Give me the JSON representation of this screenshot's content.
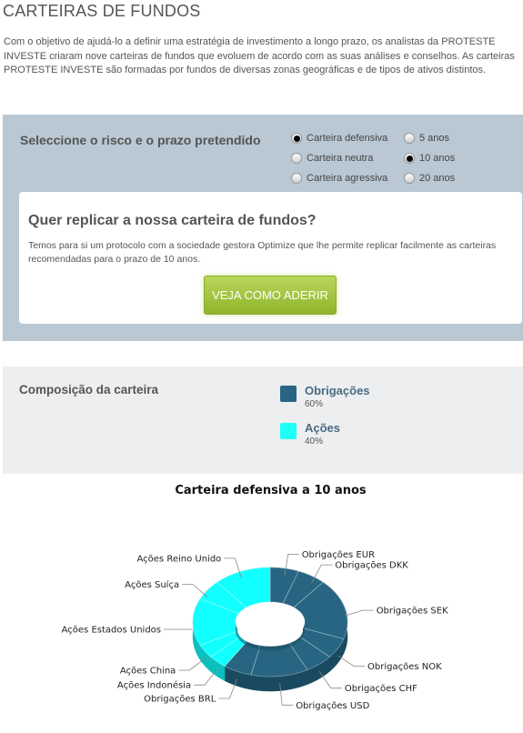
{
  "page": {
    "title": "CARTEIRAS DE FUNDOS",
    "intro": "Com o objetivo de ajudá-lo a definir uma estratégia de investimento a longo prazo, os analistas da PROTESTE INVESTE criaram nove carteiras de fundos que evoluem de acordo com as suas análises e conselhos. As carteiras PROTESTE INVESTE são formadas por fundos de diversas zonas geográficas e de tipos de ativos distintos."
  },
  "selector": {
    "label": "Seleccione o risco e o prazo pretendido",
    "risk_options": [
      {
        "label": "Carteira defensiva",
        "selected": true
      },
      {
        "label": "Carteira neutra",
        "selected": false
      },
      {
        "label": "Carteira agressiva",
        "selected": false
      }
    ],
    "term_options": [
      {
        "label": "5 anos",
        "selected": false
      },
      {
        "label": "10 anos",
        "selected": true
      },
      {
        "label": "20 anos",
        "selected": false
      }
    ]
  },
  "promo": {
    "title": "Quer replicar a nossa carteira de fundos?",
    "text": "Temos para si um protocolo com a sociedade gestora Optimize que lhe permite replicar facilmente as carteiras recomendadas para o prazo de 10 anos.",
    "button_label": "VEJA COMO ADERIR"
  },
  "composition": {
    "label": "Composição da carteira",
    "legend": [
      {
        "name": "Obrigações",
        "pct": "60%",
        "color": "#276582"
      },
      {
        "name": "Ações",
        "pct": "40%",
        "color": "#1efff7"
      }
    ]
  },
  "chart_data": {
    "type": "pie",
    "title": "Carteira defensiva a 10 anos",
    "colors": {
      "bonds": "#276582",
      "bonds_dark": "#1a4a60",
      "equities": "#12ffff",
      "equities_dark": "#0bbfbf"
    },
    "slices": [
      {
        "label": "Obrigações EUR",
        "value": 6,
        "group": "bonds"
      },
      {
        "label": "Obrigações DKK",
        "value": 6,
        "group": "bonds"
      },
      {
        "label": "Obrigações SEK",
        "value": 18,
        "group": "bonds"
      },
      {
        "label": "Obrigações NOK",
        "value": 6,
        "group": "bonds"
      },
      {
        "label": "Obrigações CHF",
        "value": 6,
        "group": "bonds"
      },
      {
        "label": "Obrigações USD",
        "value": 12,
        "group": "bonds"
      },
      {
        "label": "Obrigações BRL",
        "value": 6,
        "group": "bonds"
      },
      {
        "label": "Ações Indonésia",
        "value": 4,
        "group": "equities"
      },
      {
        "label": "Ações China",
        "value": 4,
        "group": "equities"
      },
      {
        "label": "Ações Estados Unidos",
        "value": 14,
        "group": "equities"
      },
      {
        "label": "Ações Suíça",
        "value": 6,
        "group": "equities"
      },
      {
        "label": "Ações Reino Unido",
        "value": 12,
        "group": "equities"
      }
    ]
  }
}
